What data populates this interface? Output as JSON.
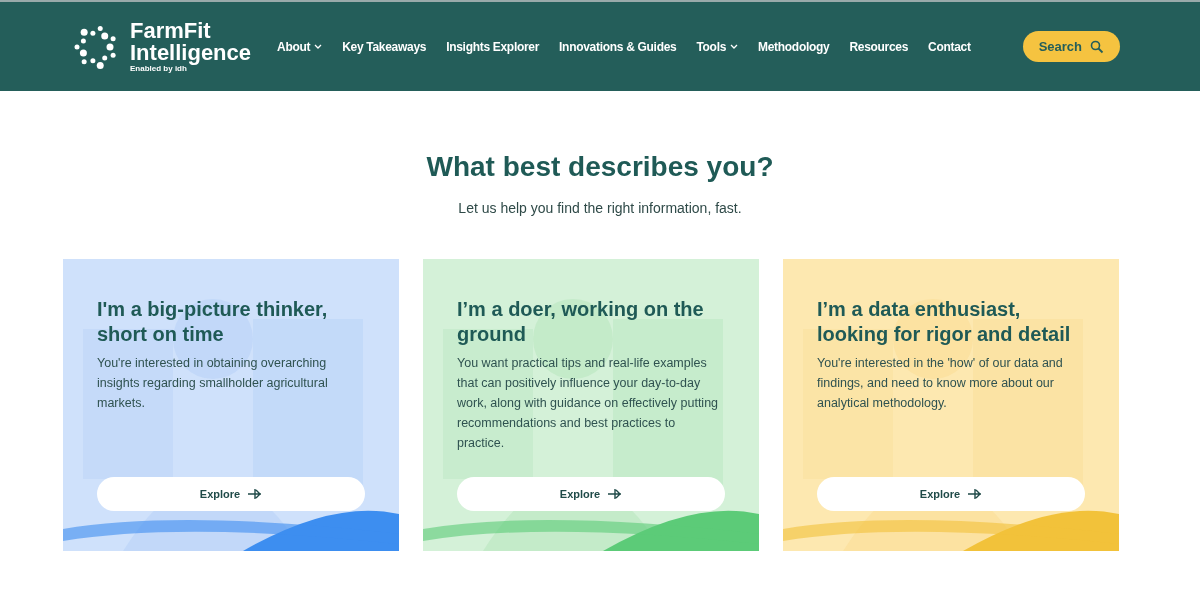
{
  "header": {
    "logo": {
      "name_line_1": "FarmFit",
      "name_line_2": "Intelligence",
      "tagline": "Enabled by idh"
    },
    "nav": [
      {
        "label": "About",
        "has_menu": true
      },
      {
        "label": "Key Takeaways",
        "has_menu": false
      },
      {
        "label": "Insights Explorer",
        "has_menu": false
      },
      {
        "label": "Innovations & Guides",
        "has_menu": false
      },
      {
        "label": "Tools",
        "has_menu": true
      },
      {
        "label": "Methodology",
        "has_menu": false
      },
      {
        "label": "Resources",
        "has_menu": false
      },
      {
        "label": "Contact",
        "has_menu": false
      }
    ],
    "search_button": "Search"
  },
  "intro": {
    "title": "What best describes you?",
    "subtitle": "Let us help you find the right information, fast."
  },
  "cards": [
    {
      "title": "I'm a big-picture thinker, short on time",
      "text": "You're interested in obtaining overarching insights regarding smallholder agricultural markets.",
      "button": "Explore",
      "color": "#cfe1fb"
    },
    {
      "title": "I’m a doer, working on the ground",
      "text": "You want practical tips and real-life examples that can positively influence your day-to-day work, along with guidance on effectively putting recommendations and best practices to practice.",
      "button": "Explore",
      "color": "#d4f1d8"
    },
    {
      "title": "I’m a data enthusiast, looking for rigor and detail",
      "text": "You're interested in the 'how' of our data and findings, and need to know more about our analytical methodology.",
      "button": "Explore",
      "color": "#fde8b0"
    }
  ]
}
